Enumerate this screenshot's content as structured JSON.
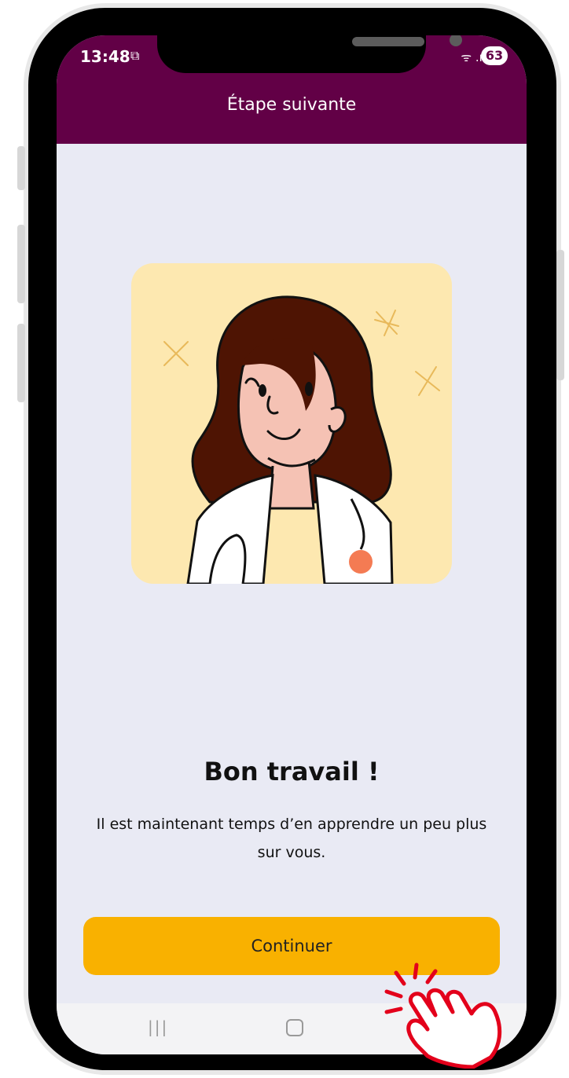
{
  "status_bar": {
    "time": "13:48",
    "screenshot_indicator": "⧉",
    "signal_icons": "ᯤ .ıl",
    "battery_level": "63"
  },
  "app_bar": {
    "title": "Étape suivante",
    "background_color": "#620046"
  },
  "illustration": {
    "icon": "doctor-woman-illustration",
    "background_color": "#fde8b0"
  },
  "content": {
    "headline": "Bon travail !",
    "description": "Il est maintenant temps d’en apprendre un peu plus sur vous."
  },
  "primary_button": {
    "label": "Continuer",
    "color": "#f9b100"
  },
  "nav_bar": {
    "recent_icon": "|||",
    "home_icon": "home-icon",
    "back_icon": "back-icon"
  },
  "overlay": {
    "icon": "hand-tap-icon",
    "color": "#e3001b"
  }
}
